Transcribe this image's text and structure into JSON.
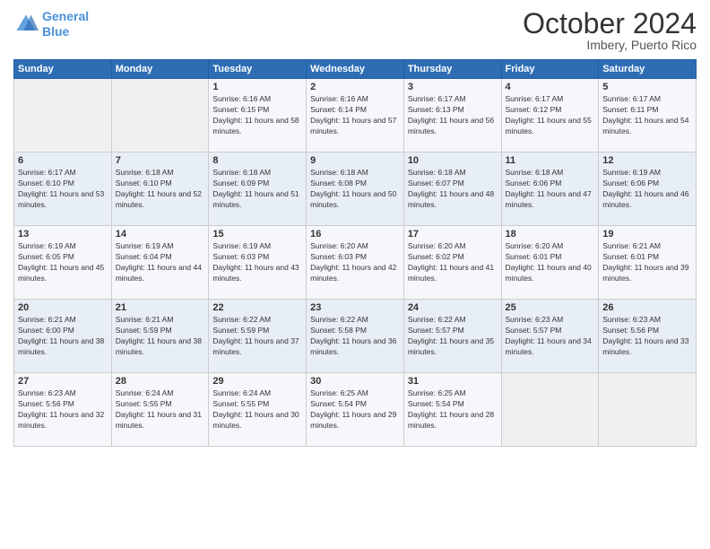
{
  "header": {
    "logo_line1": "General",
    "logo_line2": "Blue",
    "month": "October 2024",
    "location": "Imbery, Puerto Rico"
  },
  "weekdays": [
    "Sunday",
    "Monday",
    "Tuesday",
    "Wednesday",
    "Thursday",
    "Friday",
    "Saturday"
  ],
  "weeks": [
    [
      {
        "day": "",
        "info": ""
      },
      {
        "day": "",
        "info": ""
      },
      {
        "day": "1",
        "info": "Sunrise: 6:16 AM\nSunset: 6:15 PM\nDaylight: 11 hours and 58 minutes."
      },
      {
        "day": "2",
        "info": "Sunrise: 6:16 AM\nSunset: 6:14 PM\nDaylight: 11 hours and 57 minutes."
      },
      {
        "day": "3",
        "info": "Sunrise: 6:17 AM\nSunset: 6:13 PM\nDaylight: 11 hours and 56 minutes."
      },
      {
        "day": "4",
        "info": "Sunrise: 6:17 AM\nSunset: 6:12 PM\nDaylight: 11 hours and 55 minutes."
      },
      {
        "day": "5",
        "info": "Sunrise: 6:17 AM\nSunset: 6:11 PM\nDaylight: 11 hours and 54 minutes."
      }
    ],
    [
      {
        "day": "6",
        "info": "Sunrise: 6:17 AM\nSunset: 6:10 PM\nDaylight: 11 hours and 53 minutes."
      },
      {
        "day": "7",
        "info": "Sunrise: 6:18 AM\nSunset: 6:10 PM\nDaylight: 11 hours and 52 minutes."
      },
      {
        "day": "8",
        "info": "Sunrise: 6:18 AM\nSunset: 6:09 PM\nDaylight: 11 hours and 51 minutes."
      },
      {
        "day": "9",
        "info": "Sunrise: 6:18 AM\nSunset: 6:08 PM\nDaylight: 11 hours and 50 minutes."
      },
      {
        "day": "10",
        "info": "Sunrise: 6:18 AM\nSunset: 6:07 PM\nDaylight: 11 hours and 48 minutes."
      },
      {
        "day": "11",
        "info": "Sunrise: 6:18 AM\nSunset: 6:06 PM\nDaylight: 11 hours and 47 minutes."
      },
      {
        "day": "12",
        "info": "Sunrise: 6:19 AM\nSunset: 6:06 PM\nDaylight: 11 hours and 46 minutes."
      }
    ],
    [
      {
        "day": "13",
        "info": "Sunrise: 6:19 AM\nSunset: 6:05 PM\nDaylight: 11 hours and 45 minutes."
      },
      {
        "day": "14",
        "info": "Sunrise: 6:19 AM\nSunset: 6:04 PM\nDaylight: 11 hours and 44 minutes."
      },
      {
        "day": "15",
        "info": "Sunrise: 6:19 AM\nSunset: 6:03 PM\nDaylight: 11 hours and 43 minutes."
      },
      {
        "day": "16",
        "info": "Sunrise: 6:20 AM\nSunset: 6:03 PM\nDaylight: 11 hours and 42 minutes."
      },
      {
        "day": "17",
        "info": "Sunrise: 6:20 AM\nSunset: 6:02 PM\nDaylight: 11 hours and 41 minutes."
      },
      {
        "day": "18",
        "info": "Sunrise: 6:20 AM\nSunset: 6:01 PM\nDaylight: 11 hours and 40 minutes."
      },
      {
        "day": "19",
        "info": "Sunrise: 6:21 AM\nSunset: 6:01 PM\nDaylight: 11 hours and 39 minutes."
      }
    ],
    [
      {
        "day": "20",
        "info": "Sunrise: 6:21 AM\nSunset: 6:00 PM\nDaylight: 11 hours and 38 minutes."
      },
      {
        "day": "21",
        "info": "Sunrise: 6:21 AM\nSunset: 5:59 PM\nDaylight: 11 hours and 38 minutes."
      },
      {
        "day": "22",
        "info": "Sunrise: 6:22 AM\nSunset: 5:59 PM\nDaylight: 11 hours and 37 minutes."
      },
      {
        "day": "23",
        "info": "Sunrise: 6:22 AM\nSunset: 5:58 PM\nDaylight: 11 hours and 36 minutes."
      },
      {
        "day": "24",
        "info": "Sunrise: 6:22 AM\nSunset: 5:57 PM\nDaylight: 11 hours and 35 minutes."
      },
      {
        "day": "25",
        "info": "Sunrise: 6:23 AM\nSunset: 5:57 PM\nDaylight: 11 hours and 34 minutes."
      },
      {
        "day": "26",
        "info": "Sunrise: 6:23 AM\nSunset: 5:56 PM\nDaylight: 11 hours and 33 minutes."
      }
    ],
    [
      {
        "day": "27",
        "info": "Sunrise: 6:23 AM\nSunset: 5:56 PM\nDaylight: 11 hours and 32 minutes."
      },
      {
        "day": "28",
        "info": "Sunrise: 6:24 AM\nSunset: 5:55 PM\nDaylight: 11 hours and 31 minutes."
      },
      {
        "day": "29",
        "info": "Sunrise: 6:24 AM\nSunset: 5:55 PM\nDaylight: 11 hours and 30 minutes."
      },
      {
        "day": "30",
        "info": "Sunrise: 6:25 AM\nSunset: 5:54 PM\nDaylight: 11 hours and 29 minutes."
      },
      {
        "day": "31",
        "info": "Sunrise: 6:25 AM\nSunset: 5:54 PM\nDaylight: 11 hours and 28 minutes."
      },
      {
        "day": "",
        "info": ""
      },
      {
        "day": "",
        "info": ""
      }
    ]
  ]
}
